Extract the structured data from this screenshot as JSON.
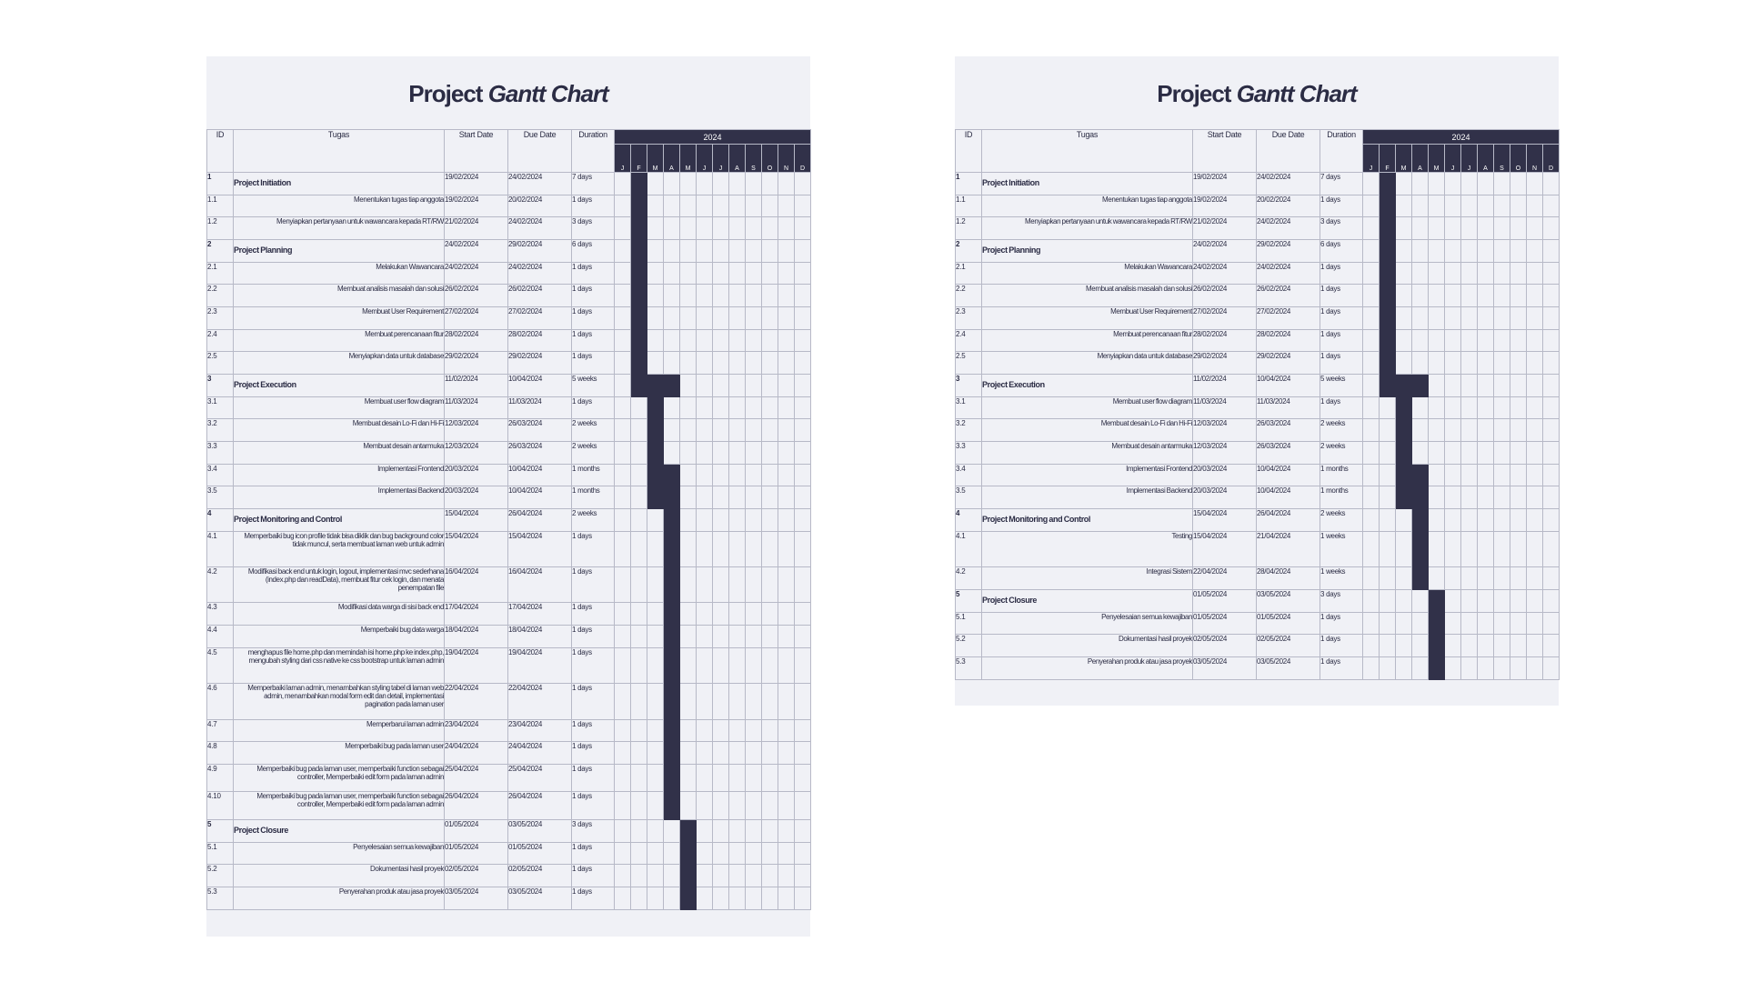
{
  "colors": {
    "bar": "#313149",
    "sheet": "#f0f1f6",
    "grid": "#b7b9c7"
  },
  "sheets": [
    {
      "title_a": "Project",
      "title_b": "Gantt Chart",
      "headers": {
        "id": "ID",
        "task": "Tugas",
        "start": "Start Date",
        "due": "Due Date",
        "duration": "Duration",
        "year": "2024"
      },
      "months": [
        "J",
        "F",
        "M",
        "A",
        "M",
        "J",
        "J",
        "A",
        "S",
        "O",
        "N",
        "D"
      ],
      "rows": [
        {
          "id": "1",
          "task": "Project Initiation",
          "start": "19/02/2024",
          "due": "24/02/2024",
          "dur": "7 days",
          "phase": true,
          "bar": [
            1,
            1
          ],
          "h": 25
        },
        {
          "id": "1.1",
          "task": "Menentukan tugas tiap anggota",
          "start": "19/02/2024",
          "due": "20/02/2024",
          "dur": "1 days",
          "bar": [
            1,
            1
          ],
          "h": 24
        },
        {
          "id": "1.2",
          "task": "Menyiapkan pertanyaan untuk wawancara kepada RT/RW",
          "start": "21/02/2024",
          "due": "24/02/2024",
          "dur": "3 days",
          "bar": [
            1,
            1
          ],
          "h": 25
        },
        {
          "id": "2",
          "task": "Project Planning",
          "start": "24/02/2024",
          "due": "29/02/2024",
          "dur": "6 days",
          "phase": true,
          "bar": [
            1,
            1
          ],
          "h": 25
        },
        {
          "id": "2.1",
          "task": "Melakukan Wawancara",
          "start": "24/02/2024",
          "due": "24/02/2024",
          "dur": "1 days",
          "bar": [
            1,
            1
          ],
          "h": 24
        },
        {
          "id": "2.2",
          "task": "Membuat analisis masalah dan solusi",
          "start": "26/02/2024",
          "due": "26/02/2024",
          "dur": "1 days",
          "bar": [
            1,
            1
          ],
          "h": 25
        },
        {
          "id": "2.3",
          "task": "Membuat User Requirement",
          "start": "27/02/2024",
          "due": "27/02/2024",
          "dur": "1 days",
          "bar": [
            1,
            1
          ],
          "h": 25
        },
        {
          "id": "2.4",
          "task": "Membuat perencanaan fitur",
          "start": "28/02/2024",
          "due": "28/02/2024",
          "dur": "1 days",
          "bar": [
            1,
            1
          ],
          "h": 24
        },
        {
          "id": "2.5",
          "task": "Menyiapkan data untuk database",
          "start": "29/02/2024",
          "due": "29/02/2024",
          "dur": "1 days",
          "bar": [
            1,
            1
          ],
          "h": 25
        },
        {
          "id": "3",
          "task": "Project Execution",
          "start": "11/02/2024",
          "due": "10/04/2024",
          "dur": "5 weeks",
          "phase": true,
          "bar": [
            1,
            3
          ],
          "h": 25
        },
        {
          "id": "3.1",
          "task": "Membuat user flow diagram",
          "start": "11/03/2024",
          "due": "11/03/2024",
          "dur": "1 days",
          "bar": [
            2,
            2
          ],
          "h": 24
        },
        {
          "id": "3.2",
          "task": "Membuat desain Lo-Fi dan Hi-Fi",
          "start": "12/03/2024",
          "due": "26/03/2024",
          "dur": "2 weeks",
          "bar": [
            2,
            2
          ],
          "h": 25
        },
        {
          "id": "3.3",
          "task": "Membuat desain antarmuka",
          "start": "12/03/2024",
          "due": "26/03/2024",
          "dur": "2 weeks",
          "bar": [
            2,
            2
          ],
          "h": 25
        },
        {
          "id": "3.4",
          "task": "Implementasi Frontend",
          "start": "20/03/2024",
          "due": "10/04/2024",
          "dur": "1 months",
          "bar": [
            2,
            3
          ],
          "h": 24
        },
        {
          "id": "3.5",
          "task": "Implementasi Backend",
          "start": "20/03/2024",
          "due": "10/04/2024",
          "dur": "1 months",
          "bar": [
            2,
            3
          ],
          "h": 25
        },
        {
          "id": "4",
          "task": "Project Monitoring and Control",
          "start": "15/04/2024",
          "due": "26/04/2024",
          "dur": "2 weeks",
          "phase": true,
          "bar": [
            3,
            3
          ],
          "h": 25
        },
        {
          "id": "4.1",
          "task": "Memperbaiki bug icon profile tidak bisa diklik dan bug background color tidak muncul, serta membuat laman web untuk admin",
          "start": "15/04/2024",
          "due": "15/04/2024",
          "dur": "1 days",
          "bar": [
            3,
            3
          ],
          "h": 39
        },
        {
          "id": "4.2",
          "task": "Modifikasi back end untuk login, logout, implementasi mvc sederhana (index.php dan readData), membuat fitur cek login, dan menata penempatan file",
          "start": "16/04/2024",
          "due": "16/04/2024",
          "dur": "1 days",
          "bar": [
            3,
            3
          ],
          "h": 39
        },
        {
          "id": "4.3",
          "task": "Modifikasi data warga di sisi back end",
          "start": "17/04/2024",
          "due": "17/04/2024",
          "dur": "1 days",
          "bar": [
            3,
            3
          ],
          "h": 25
        },
        {
          "id": "4.4",
          "task": "Memperbaiki bug data warga",
          "start": "18/04/2024",
          "due": "18/04/2024",
          "dur": "1 days",
          "bar": [
            3,
            3
          ],
          "h": 25
        },
        {
          "id": "4.5",
          "task": "menghapus file home.php dan memindah isi home.php ke index.php, mengubah styling dari css native ke css bootstrap untuk laman admin",
          "start": "19/04/2024",
          "due": "19/04/2024",
          "dur": "1 days",
          "bar": [
            3,
            3
          ],
          "h": 39
        },
        {
          "id": "4.6",
          "task": "Memperbaiki laman admin, menambahkan styling tabel di laman web admin, menambahkan modal form edit dan detail, implementasi pagination pada laman user",
          "start": "22/04/2024",
          "due": "22/04/2024",
          "dur": "1 days",
          "bar": [
            3,
            3
          ],
          "h": 40
        },
        {
          "id": "4.7",
          "task": "Memperbarui laman admin",
          "start": "23/04/2024",
          "due": "23/04/2024",
          "dur": "1 days",
          "bar": [
            3,
            3
          ],
          "h": 24
        },
        {
          "id": "4.8",
          "task": "Memperbaiki bug pada laman user",
          "start": "24/04/2024",
          "due": "24/04/2024",
          "dur": "1 days",
          "bar": [
            3,
            3
          ],
          "h": 25
        },
        {
          "id": "4.9",
          "task": "Memperbaiki bug pada laman user, memperbaiki function sebagai controller, Memperbaiki edit form pada laman admin",
          "start": "25/04/2024",
          "due": "25/04/2024",
          "dur": "1 days",
          "bar": [
            3,
            3
          ],
          "h": 30
        },
        {
          "id": "4.10",
          "task": "Memperbaiki bug pada laman user, memperbaiki function sebagai controller, Memperbaiki edit form pada laman admin",
          "start": "26/04/2024",
          "due": "26/04/2024",
          "dur": "1 days",
          "bar": [
            3,
            3
          ],
          "h": 31
        },
        {
          "id": "5",
          "task": "Project Closure",
          "start": "01/05/2024",
          "due": "03/05/2024",
          "dur": "3 days",
          "phase": true,
          "bar": [
            4,
            4
          ],
          "h": 25
        },
        {
          "id": "5.1",
          "task": "Penyelesaian semua kewajiban",
          "start": "01/05/2024",
          "due": "01/05/2024",
          "dur": "1 days",
          "bar": [
            4,
            4
          ],
          "h": 24
        },
        {
          "id": "5.2",
          "task": "Dokumentasi hasil proyek",
          "start": "02/05/2024",
          "due": "02/05/2024",
          "dur": "1 days",
          "bar": [
            4,
            4
          ],
          "h": 25
        },
        {
          "id": "5.3",
          "task": "Penyerahan produk atau jasa proyek",
          "start": "03/05/2024",
          "due": "03/05/2024",
          "dur": "1 days",
          "bar": [
            4,
            4
          ],
          "h": 25
        }
      ]
    },
    {
      "title_a": "Project",
      "title_b": "Gantt Chart",
      "headers": {
        "id": "ID",
        "task": "Tugas",
        "start": "Start Date",
        "due": "Due Date",
        "duration": "Duration",
        "year": "2024"
      },
      "months": [
        "J",
        "F",
        "M",
        "A",
        "M",
        "J",
        "J",
        "A",
        "S",
        "O",
        "N",
        "D"
      ],
      "rows": [
        {
          "id": "1",
          "task": "Project Initiation",
          "start": "19/02/2024",
          "due": "24/02/2024",
          "dur": "7 days",
          "phase": true,
          "bar": [
            1,
            1
          ],
          "h": 25
        },
        {
          "id": "1.1",
          "task": "Menentukan tugas tiap anggota",
          "start": "19/02/2024",
          "due": "20/02/2024",
          "dur": "1 days",
          "bar": [
            1,
            1
          ],
          "h": 24
        },
        {
          "id": "1.2",
          "task": "Menyiapkan pertanyaan untuk wawancara kepada RT/RW",
          "start": "21/02/2024",
          "due": "24/02/2024",
          "dur": "3 days",
          "bar": [
            1,
            1
          ],
          "h": 25
        },
        {
          "id": "2",
          "task": "Project Planning",
          "start": "24/02/2024",
          "due": "29/02/2024",
          "dur": "6 days",
          "phase": true,
          "bar": [
            1,
            1
          ],
          "h": 25
        },
        {
          "id": "2.1",
          "task": "Melakukan Wawancara",
          "start": "24/02/2024",
          "due": "24/02/2024",
          "dur": "1 days",
          "bar": [
            1,
            1
          ],
          "h": 24
        },
        {
          "id": "2.2",
          "task": "Membuat analisis masalah dan solusi",
          "start": "26/02/2024",
          "due": "26/02/2024",
          "dur": "1 days",
          "bar": [
            1,
            1
          ],
          "h": 25
        },
        {
          "id": "2.3",
          "task": "Membuat User Requirement",
          "start": "27/02/2024",
          "due": "27/02/2024",
          "dur": "1 days",
          "bar": [
            1,
            1
          ],
          "h": 25
        },
        {
          "id": "2.4",
          "task": "Membuat perencanaan fitur",
          "start": "28/02/2024",
          "due": "28/02/2024",
          "dur": "1 days",
          "bar": [
            1,
            1
          ],
          "h": 24
        },
        {
          "id": "2.5",
          "task": "Menyiapkan data untuk database",
          "start": "29/02/2024",
          "due": "29/02/2024",
          "dur": "1 days",
          "bar": [
            1,
            1
          ],
          "h": 25
        },
        {
          "id": "3",
          "task": "Project Execution",
          "start": "11/02/2024",
          "due": "10/04/2024",
          "dur": "5 weeks",
          "phase": true,
          "bar": [
            1,
            3
          ],
          "h": 25
        },
        {
          "id": "3.1",
          "task": "Membuat user flow diagram",
          "start": "11/03/2024",
          "due": "11/03/2024",
          "dur": "1 days",
          "bar": [
            2,
            2
          ],
          "h": 24
        },
        {
          "id": "3.2",
          "task": "Membuat desain Lo-Fi dan Hi-Fi",
          "start": "12/03/2024",
          "due": "26/03/2024",
          "dur": "2 weeks",
          "bar": [
            2,
            2
          ],
          "h": 25
        },
        {
          "id": "3.3",
          "task": "Membuat desain antarmuka",
          "start": "12/03/2024",
          "due": "26/03/2024",
          "dur": "2 weeks",
          "bar": [
            2,
            2
          ],
          "h": 25
        },
        {
          "id": "3.4",
          "task": "Implementasi Frontend",
          "start": "20/03/2024",
          "due": "10/04/2024",
          "dur": "1 months",
          "bar": [
            2,
            3
          ],
          "h": 24
        },
        {
          "id": "3.5",
          "task": "Implementasi Backend",
          "start": "20/03/2024",
          "due": "10/04/2024",
          "dur": "1 months",
          "bar": [
            2,
            3
          ],
          "h": 25
        },
        {
          "id": "4",
          "task": "Project Monitoring and Control",
          "start": "15/04/2024",
          "due": "26/04/2024",
          "dur": "2 weeks",
          "phase": true,
          "bar": [
            3,
            3
          ],
          "h": 25
        },
        {
          "id": "4.1",
          "task": "Testing",
          "start": "15/04/2024",
          "due": "21/04/2024",
          "dur": "1 weeks",
          "bar": [
            3,
            3
          ],
          "h": 39
        },
        {
          "id": "4.2",
          "task": "Integrasi Sistem",
          "start": "22/04/2024",
          "due": "28/04/2024",
          "dur": "1 weeks",
          "bar": [
            3,
            3
          ],
          "h": 25
        },
        {
          "id": "5",
          "task": "Project Closure",
          "start": "01/05/2024",
          "due": "03/05/2024",
          "dur": "3 days",
          "phase": true,
          "bar": [
            4,
            4
          ],
          "h": 25
        },
        {
          "id": "5.1",
          "task": "Penyelesaian semua kewajiban",
          "start": "01/05/2024",
          "due": "01/05/2024",
          "dur": "1 days",
          "bar": [
            4,
            4
          ],
          "h": 24
        },
        {
          "id": "5.2",
          "task": "Dokumentasi hasil proyek",
          "start": "02/05/2024",
          "due": "02/05/2024",
          "dur": "1 days",
          "bar": [
            4,
            4
          ],
          "h": 25
        },
        {
          "id": "5.3",
          "task": "Penyerahan produk atau jasa proyek",
          "start": "03/05/2024",
          "due": "03/05/2024",
          "dur": "1 days",
          "bar": [
            4,
            4
          ],
          "h": 25
        }
      ]
    }
  ]
}
